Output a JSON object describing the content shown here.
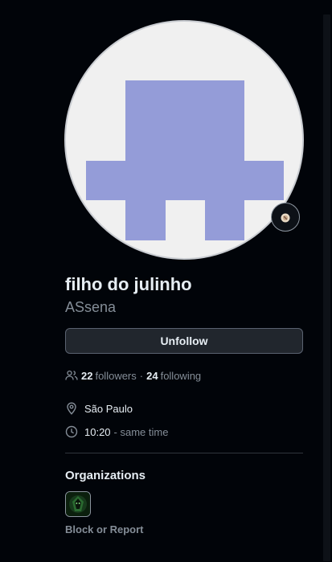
{
  "profile": {
    "display_name": "filho do julinho",
    "username": "ASsena",
    "status_icon": "status-emoji-icon"
  },
  "actions": {
    "unfollow_label": "Unfollow"
  },
  "stats": {
    "followers_count": "22",
    "followers_label": "followers",
    "separator": "·",
    "following_count": "24",
    "following_label": "following"
  },
  "details": {
    "location": "São Paulo",
    "local_time": "10:20",
    "time_note": "- same time"
  },
  "organizations": {
    "heading": "Organizations"
  },
  "footer": {
    "block_report_label": "Block or Report"
  },
  "colors": {
    "background": "#010409",
    "avatar_bg": "#f0f0f0",
    "identicon": "#949cd8",
    "muted_text": "#848d97",
    "button_bg": "#21262d"
  }
}
